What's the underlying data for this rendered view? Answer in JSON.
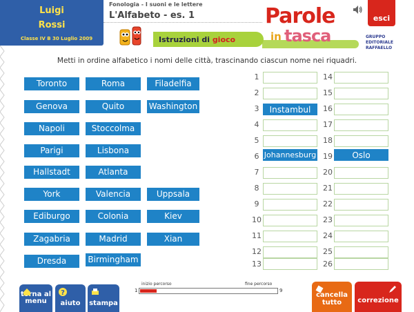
{
  "header": {
    "first_name": "Luigi",
    "last_name": "Rossi",
    "class_label": "Classe IV B",
    "date": "30 Luglio 2009",
    "subtitle": "Fonologia - I suoni e le lettere",
    "exercise_title": "L'Alfabeto - es. 1",
    "instructions_prefix": "Istruzioni di",
    "instructions_word": "gioco",
    "logo_parole": "Parole",
    "logo_in": "in",
    "logo_tasca": "tasca",
    "publisher": "GRUPPO EDITORIALE RAFFAELLO",
    "exit_label": "esci"
  },
  "instruction": "Metti in ordine alfabetico i nomi delle città, trascinando ciascun nome nei riquadri.",
  "cities": [
    {
      "name": "Toronto"
    },
    {
      "name": "Roma"
    },
    {
      "name": "Filadelfia"
    },
    {
      "name": "Genova"
    },
    {
      "name": "Quito"
    },
    {
      "name": "Washington"
    },
    {
      "name": "Napoli"
    },
    {
      "name": "Stoccolma"
    },
    {
      "name": "Parigi"
    },
    {
      "name": "Lisbona"
    },
    {
      "name": "Hallstadt"
    },
    {
      "name": "Atlanta"
    },
    {
      "name": "York"
    },
    {
      "name": "Valencia"
    },
    {
      "name": "Uppsala"
    },
    {
      "name": "Ediburgo"
    },
    {
      "name": "Colonia"
    },
    {
      "name": "Kiev"
    },
    {
      "name": "Zagabria"
    },
    {
      "name": "Madrid"
    },
    {
      "name": "Xian"
    },
    {
      "name": "Dresda"
    },
    {
      "name": "Birmingham"
    }
  ],
  "slots": [
    {
      "num": "1",
      "value": ""
    },
    {
      "num": "2",
      "value": ""
    },
    {
      "num": "3",
      "value": "Instambul"
    },
    {
      "num": "4",
      "value": ""
    },
    {
      "num": "5",
      "value": ""
    },
    {
      "num": "6",
      "value": "Johannesburg"
    },
    {
      "num": "7",
      "value": ""
    },
    {
      "num": "8",
      "value": ""
    },
    {
      "num": "9",
      "value": ""
    },
    {
      "num": "10",
      "value": ""
    },
    {
      "num": "11",
      "value": ""
    },
    {
      "num": "12",
      "value": ""
    },
    {
      "num": "13",
      "value": ""
    },
    {
      "num": "14",
      "value": ""
    },
    {
      "num": "15",
      "value": ""
    },
    {
      "num": "16",
      "value": ""
    },
    {
      "num": "17",
      "value": ""
    },
    {
      "num": "18",
      "value": ""
    },
    {
      "num": "19",
      "value": "Oslo"
    },
    {
      "num": "20",
      "value": ""
    },
    {
      "num": "21",
      "value": ""
    },
    {
      "num": "22",
      "value": ""
    },
    {
      "num": "23",
      "value": ""
    },
    {
      "num": "24",
      "value": ""
    },
    {
      "num": "25",
      "value": ""
    },
    {
      "num": "26",
      "value": ""
    }
  ],
  "progress": {
    "start_label": "inizio percorso",
    "end_label": "fine percorso",
    "min": "1",
    "max": "9",
    "fraction": 0.12
  },
  "footer": {
    "back_line1": "torna al",
    "back_line2": "menu",
    "help": "aiuto",
    "print": "stampa",
    "clear_line1": "cancella",
    "clear_line2": "tutto",
    "check": "correzione"
  },
  "colors": {
    "tile": "#1f83c7",
    "header_blue": "#2f5fa8",
    "accent_red": "#d8261c",
    "accent_green": "#a8d23c"
  }
}
